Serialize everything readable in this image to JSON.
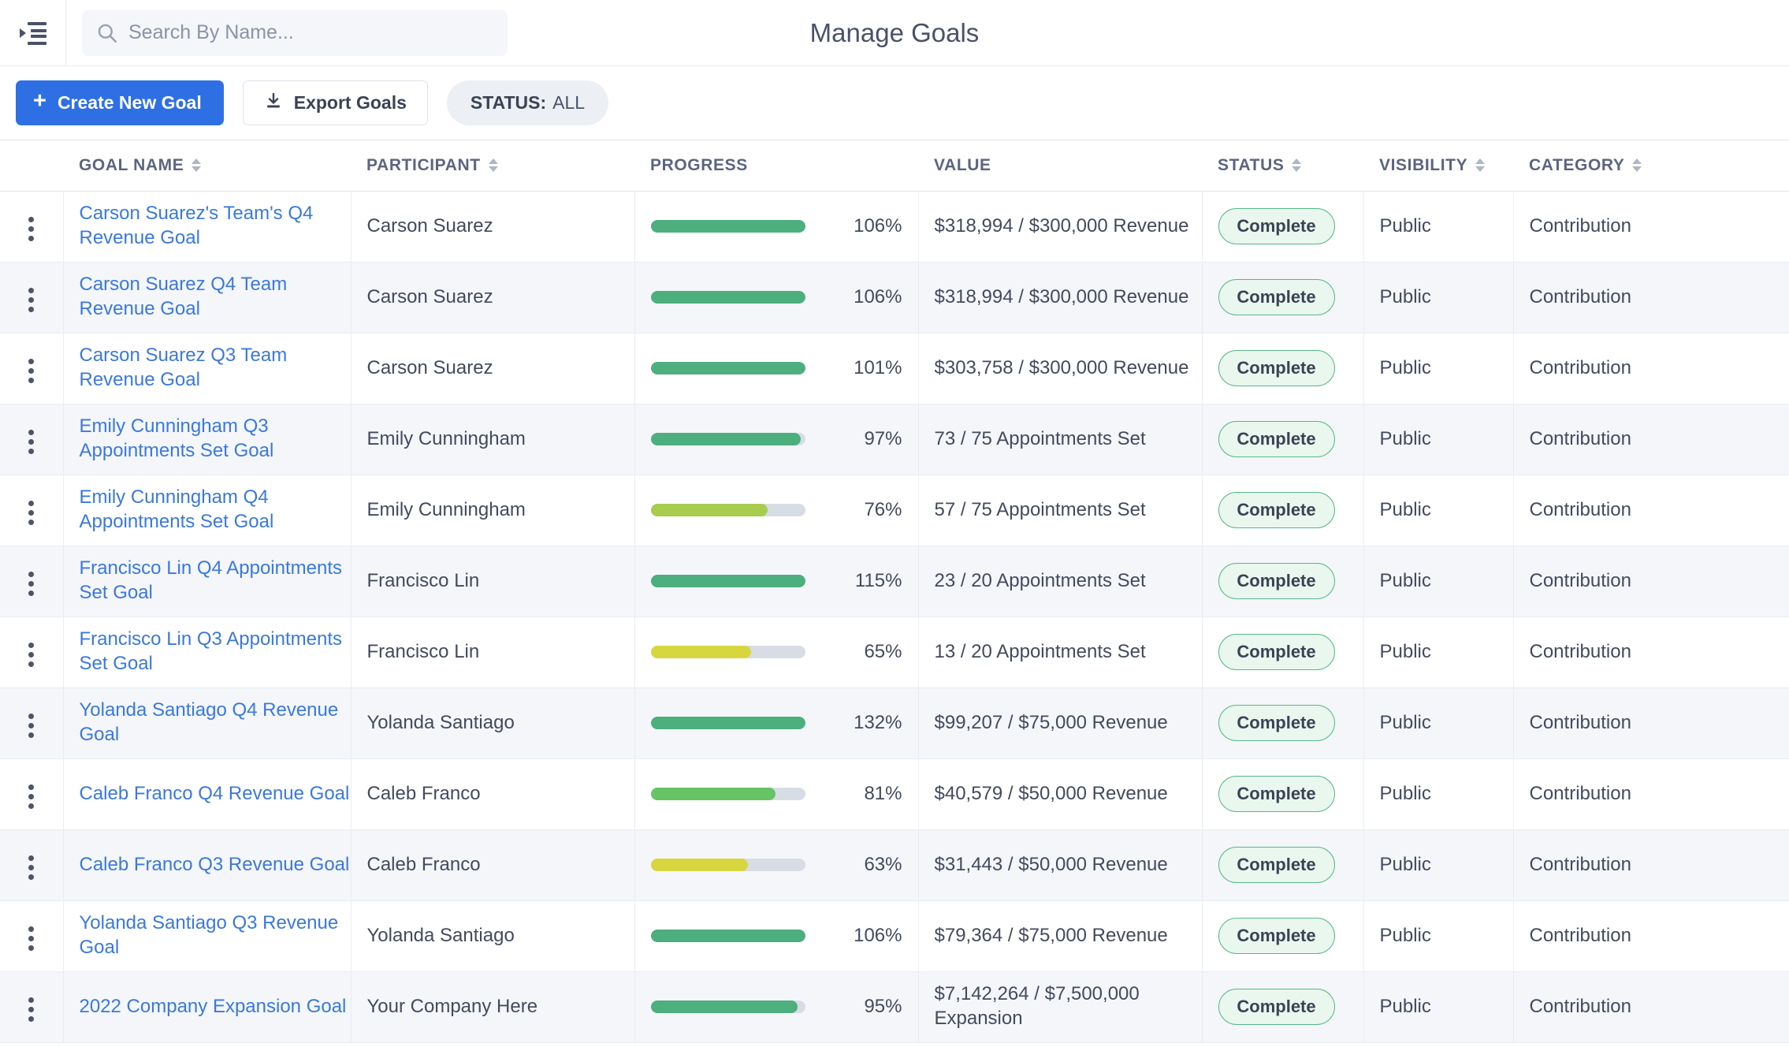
{
  "header": {
    "title": "Manage Goals",
    "sidebar_toggle_icon": "sidebar-toggle-icon",
    "search": {
      "icon": "search-icon",
      "placeholder": "Search By Name...",
      "value": ""
    }
  },
  "toolbar": {
    "create_label": "Create New Goal",
    "create_plus": "+",
    "export_label": "Export Goals",
    "export_icon": "download-icon",
    "status_filter_key": "STATUS:",
    "status_filter_value": "ALL"
  },
  "table": {
    "columns": [
      {
        "key": "menu",
        "label": "",
        "sortable": false
      },
      {
        "key": "goal_name",
        "label": "GOAL NAME",
        "sortable": true
      },
      {
        "key": "participant",
        "label": "PARTICIPANT",
        "sortable": true
      },
      {
        "key": "progress",
        "label": "PROGRESS",
        "sortable": false
      },
      {
        "key": "value",
        "label": "VALUE",
        "sortable": false
      },
      {
        "key": "status",
        "label": "STATUS",
        "sortable": true
      },
      {
        "key": "visibility",
        "label": "VISIBILITY",
        "sortable": true
      },
      {
        "key": "category",
        "label": "CATEGORY",
        "sortable": true
      }
    ],
    "rows": [
      {
        "goal_name": "Carson Suarez's Team's Q4 Revenue Goal",
        "participant": "Carson Suarez",
        "progress_pct": 106,
        "progress_label": "106%",
        "bar_fill_pct": 100,
        "bar_color": "#4CAF7D",
        "value": "$318,994 / $300,000 Revenue",
        "status": "Complete",
        "visibility": "Public",
        "category": "Contribution"
      },
      {
        "goal_name": "Carson Suarez Q4 Team Revenue Goal",
        "participant": "Carson Suarez",
        "progress_pct": 106,
        "progress_label": "106%",
        "bar_fill_pct": 100,
        "bar_color": "#4CAF7D",
        "value": "$318,994 / $300,000 Revenue",
        "status": "Complete",
        "visibility": "Public",
        "category": "Contribution"
      },
      {
        "goal_name": "Carson Suarez Q3 Team Revenue Goal",
        "participant": "Carson Suarez",
        "progress_pct": 101,
        "progress_label": "101%",
        "bar_fill_pct": 100,
        "bar_color": "#4CAF7D",
        "value": "$303,758 / $300,000 Revenue",
        "status": "Complete",
        "visibility": "Public",
        "category": "Contribution"
      },
      {
        "goal_name": "Emily Cunningham Q3 Appointments Set Goal",
        "participant": "Emily Cunningham",
        "progress_pct": 97,
        "progress_label": "97%",
        "bar_fill_pct": 97,
        "bar_color": "#4CAF7D",
        "value": "73 / 75 Appointments Set",
        "status": "Complete",
        "visibility": "Public",
        "category": "Contribution"
      },
      {
        "goal_name": "Emily Cunningham Q4 Appointments Set Goal",
        "participant": "Emily Cunningham",
        "progress_pct": 76,
        "progress_label": "76%",
        "bar_fill_pct": 76,
        "bar_color": "#A8CC4E",
        "value": "57 / 75 Appointments Set",
        "status": "Complete",
        "visibility": "Public",
        "category": "Contribution"
      },
      {
        "goal_name": "Francisco Lin Q4 Appointments Set Goal",
        "participant": "Francisco Lin",
        "progress_pct": 115,
        "progress_label": "115%",
        "bar_fill_pct": 100,
        "bar_color": "#4CAF7D",
        "value": "23 / 20 Appointments Set",
        "status": "Complete",
        "visibility": "Public",
        "category": "Contribution"
      },
      {
        "goal_name": "Francisco Lin Q3 Appointments Set Goal",
        "participant": "Francisco Lin",
        "progress_pct": 65,
        "progress_label": "65%",
        "bar_fill_pct": 65,
        "bar_color": "#D8D63F",
        "value": "13 / 20 Appointments Set",
        "status": "Complete",
        "visibility": "Public",
        "category": "Contribution"
      },
      {
        "goal_name": "Yolanda Santiago Q4 Revenue Goal",
        "participant": "Yolanda Santiago",
        "progress_pct": 132,
        "progress_label": "132%",
        "bar_fill_pct": 100,
        "bar_color": "#4CAF7D",
        "value": "$99,207 / $75,000 Revenue",
        "status": "Complete",
        "visibility": "Public",
        "category": "Contribution"
      },
      {
        "goal_name": "Caleb Franco Q4 Revenue Goal",
        "participant": "Caleb Franco",
        "progress_pct": 81,
        "progress_label": "81%",
        "bar_fill_pct": 81,
        "bar_color": "#66C465",
        "value": "$40,579 / $50,000 Revenue",
        "status": "Complete",
        "visibility": "Public",
        "category": "Contribution"
      },
      {
        "goal_name": "Caleb Franco Q3 Revenue Goal",
        "participant": "Caleb Franco",
        "progress_pct": 63,
        "progress_label": "63%",
        "bar_fill_pct": 63,
        "bar_color": "#D8D63F",
        "value": "$31,443 / $50,000 Revenue",
        "status": "Complete",
        "visibility": "Public",
        "category": "Contribution"
      },
      {
        "goal_name": "Yolanda Santiago Q3 Revenue Goal",
        "participant": "Yolanda Santiago",
        "progress_pct": 106,
        "progress_label": "106%",
        "bar_fill_pct": 100,
        "bar_color": "#4CAF7D",
        "value": "$79,364 / $75,000 Revenue",
        "status": "Complete",
        "visibility": "Public",
        "category": "Contribution"
      },
      {
        "goal_name": "2022 Company Expansion Goal",
        "participant": "Your Company Here",
        "progress_pct": 95,
        "progress_label": "95%",
        "bar_fill_pct": 95,
        "bar_color": "#4CAF7D",
        "value": "$7,142,264 / $7,500,000 Expansion",
        "status": "Complete",
        "visibility": "Public",
        "category": "Contribution"
      }
    ]
  },
  "colors": {
    "primary": "#2f6fe4",
    "link": "#3a78e0",
    "status_green": "#57b88a",
    "status_bg": "#e9f7ef",
    "bar_track": "#d8dce5"
  }
}
